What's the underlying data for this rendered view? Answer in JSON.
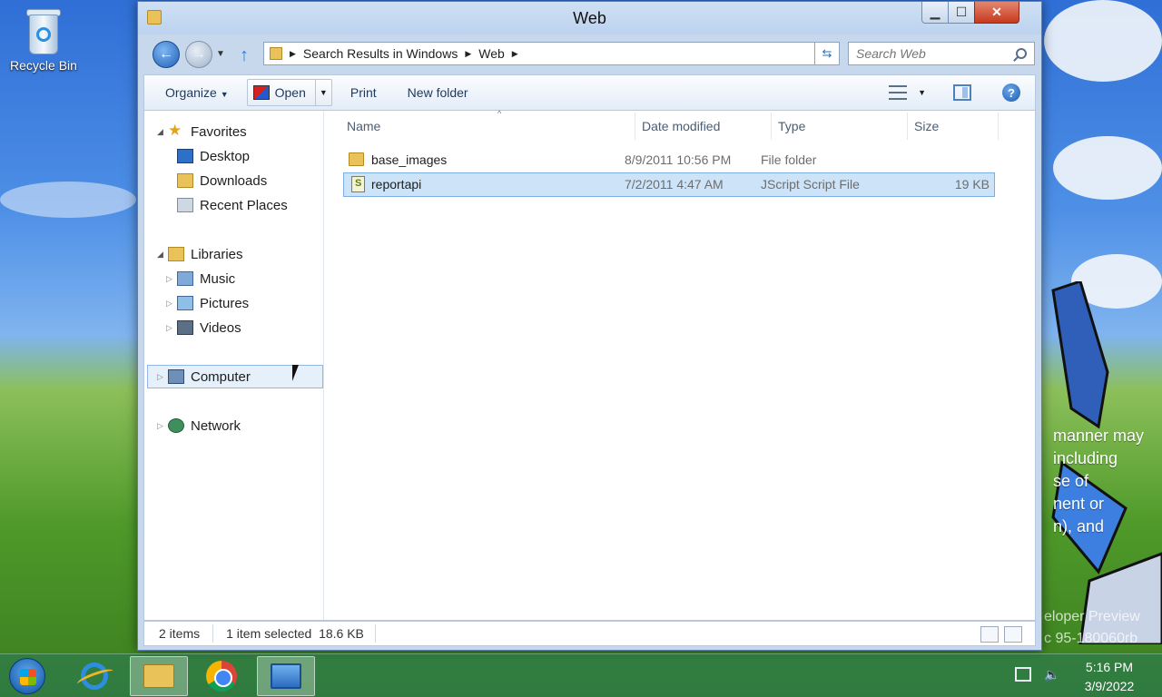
{
  "desktop": {
    "recycle_bin_label": "Recycle Bin",
    "watermark_lines": [
      "manner may",
      "including",
      "se of",
      "nent or",
      "n), and"
    ],
    "watermark_bottom_lines": [
      "eloper Preview",
      "c 95-180060rb"
    ]
  },
  "window": {
    "title": "Web",
    "buttons": {
      "minimize": "▁",
      "maximize": "☐",
      "close": "✕"
    }
  },
  "address": {
    "breadcrumbs": [
      "Search Results in Windows",
      "Web"
    ],
    "search_placeholder": "Search Web"
  },
  "toolbar": {
    "organize": "Organize",
    "open": "Open",
    "print": "Print",
    "new_folder": "New folder"
  },
  "navpane": {
    "items": [
      {
        "label": "Favorites",
        "icon": "star-icon"
      },
      {
        "label": "Desktop",
        "icon": "desktop-icon"
      },
      {
        "label": "Downloads",
        "icon": "downloads-icon"
      },
      {
        "label": "Recent Places",
        "icon": "recent-places-icon"
      },
      {
        "label": "Libraries",
        "icon": "libraries-icon"
      },
      {
        "label": "Music",
        "icon": "music-icon"
      },
      {
        "label": "Pictures",
        "icon": "pictures-icon"
      },
      {
        "label": "Videos",
        "icon": "videos-icon"
      },
      {
        "label": "Computer",
        "icon": "computer-icon"
      },
      {
        "label": "Network",
        "icon": "network-icon"
      }
    ]
  },
  "files": {
    "columns": [
      "Name",
      "Date modified",
      "Type",
      "Size"
    ],
    "rows": [
      {
        "name": "base_images",
        "date": "8/9/2011 10:56 PM",
        "type": "File folder",
        "size": "",
        "icon": "folder-icon"
      },
      {
        "name": "reportapi",
        "date": "7/2/2011 4:47 AM",
        "type": "JScript Script File",
        "size": "19 KB",
        "icon": "script-file-icon"
      }
    ]
  },
  "status": {
    "count": "2 items",
    "selection": "1 item selected  18.6 KB"
  },
  "taskbar": {
    "time": "5:16 PM",
    "date": "3/9/2022"
  }
}
